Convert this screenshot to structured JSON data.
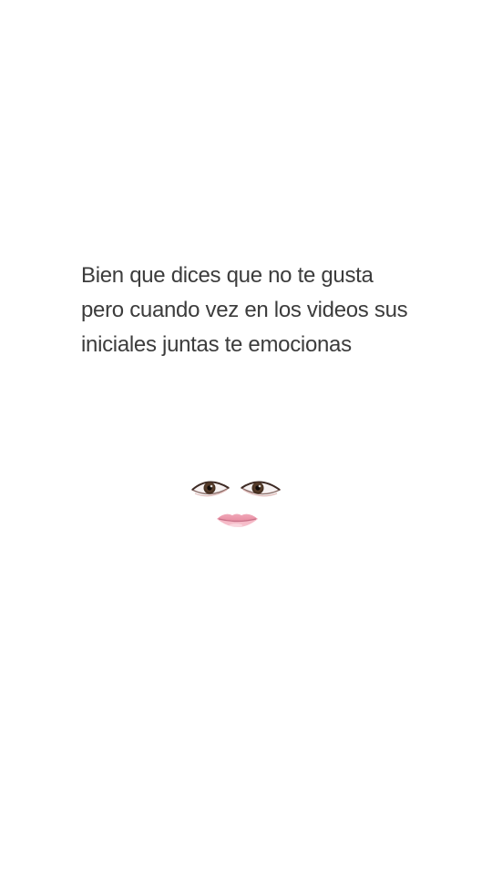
{
  "caption": {
    "lines": [
      "Bien que dices que no te gusta",
      "pero cuando vez en los videos sus",
      "iniciales juntas te emocionas"
    ]
  },
  "sticker": {
    "icon": "face-eyes-lips-icon",
    "colors": {
      "iris": "#4a3426",
      "lips": "#f2a0b3"
    }
  }
}
